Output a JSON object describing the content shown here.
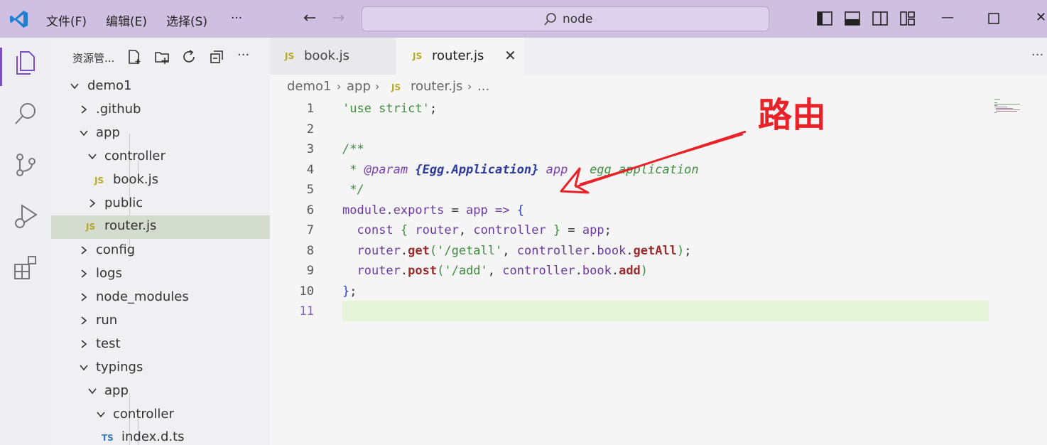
{
  "titlebar": {
    "menus": [
      "文件(F)",
      "编辑(E)",
      "选择(S)",
      "···"
    ],
    "search_text": "node"
  },
  "sidebar": {
    "header": "资源管...",
    "more": "···",
    "tree": [
      {
        "label": "demo1",
        "type": "folder-open"
      },
      {
        "label": ".github",
        "type": "folder-closed"
      },
      {
        "label": "app",
        "type": "folder-open"
      },
      {
        "label": "controller",
        "type": "folder-open"
      },
      {
        "label": "book.js",
        "type": "js"
      },
      {
        "label": "public",
        "type": "folder-closed"
      },
      {
        "label": "router.js",
        "type": "js",
        "selected": true
      },
      {
        "label": "config",
        "type": "folder-closed"
      },
      {
        "label": "logs",
        "type": "folder-closed"
      },
      {
        "label": "node_modules",
        "type": "folder-closed"
      },
      {
        "label": "run",
        "type": "folder-closed"
      },
      {
        "label": "test",
        "type": "folder-closed"
      },
      {
        "label": "typings",
        "type": "folder-open"
      },
      {
        "label": "app",
        "type": "folder-open"
      },
      {
        "label": "controller",
        "type": "folder-open"
      },
      {
        "label": "index.d.ts",
        "type": "ts"
      }
    ],
    "js_badge": "JS",
    "ts_badge": "TS"
  },
  "tabs": [
    {
      "label": "book.js",
      "active": false
    },
    {
      "label": "router.js",
      "active": true
    }
  ],
  "tab_more": "···",
  "breadcrumb": [
    "demo1",
    "app",
    "router.js",
    "..."
  ],
  "code": {
    "line_numbers": [
      "1",
      "2",
      "3",
      "4",
      "5",
      "6",
      "7",
      "8",
      "9",
      "10",
      "11"
    ],
    "current_line": "11"
  },
  "annotation": {
    "text": "路由",
    "color": "#e82228"
  },
  "colors": {
    "titlebar": "#cfc0e2",
    "accent": "#7b4fbf",
    "current_line": "#e5f3d8"
  }
}
